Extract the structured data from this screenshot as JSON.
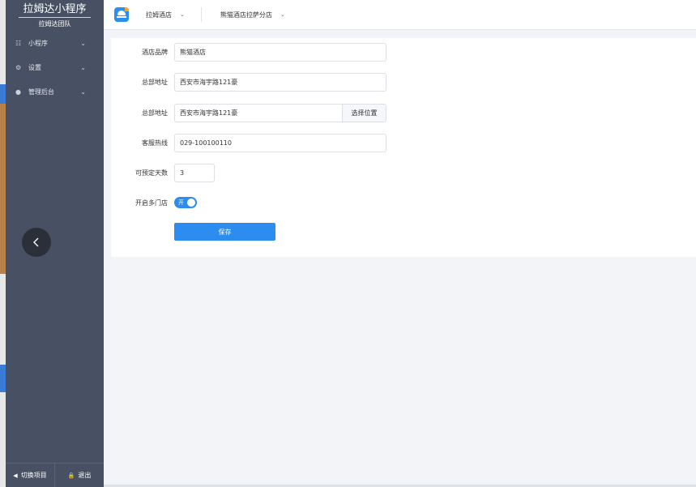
{
  "sidebar": {
    "brand_title": "拉姆达小程序",
    "brand_subtitle": "拉姆达团队",
    "items": [
      {
        "label": "小程序",
        "icon": "grid-icon"
      },
      {
        "label": "设置",
        "icon": "gear-icon"
      },
      {
        "label": "管理后台",
        "icon": "circle-icon"
      }
    ],
    "footer": {
      "switch_label": "切换项目",
      "logout_label": "退出"
    }
  },
  "header": {
    "app_select": "拉姆酒店",
    "store_select": "熊猫酒店拉萨分店"
  },
  "form": {
    "brand": {
      "label": "酒店品牌",
      "value": "熊猫酒店"
    },
    "address": {
      "label": "总部地址",
      "value": "西安市海宇路121豪"
    },
    "location": {
      "label": "总部地址",
      "value": "西安市海宇路121豪",
      "button": "选择位置"
    },
    "hotline": {
      "label": "客服热线",
      "value": "029-100100110"
    },
    "days": {
      "label": "可预定天数",
      "value": "3"
    },
    "multi_store": {
      "label": "开启多门店",
      "toggle_text": "开",
      "enabled": true
    },
    "save_label": "保存"
  },
  "colors": {
    "sidebar_bg": "#485163",
    "accent": "#2d8cf0",
    "page_bg": "#f3f4f7"
  }
}
